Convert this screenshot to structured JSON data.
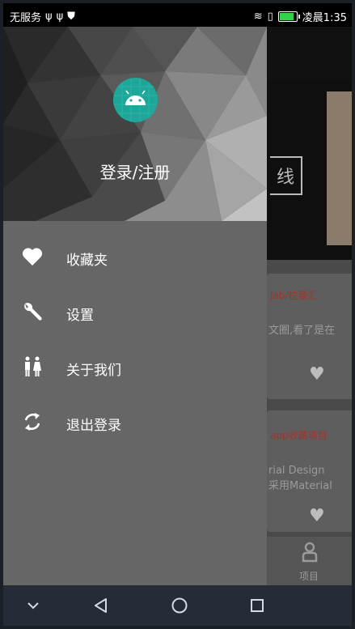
{
  "status_bar": {
    "carrier": "无服务",
    "time": "凌晨1:35"
  },
  "background": {
    "banner_text": "线",
    "card1_title": "Jab/拉曼汇",
    "card1_text": "文圈,看了是在",
    "card2_title": "app收藏项目",
    "card2_line1": "rial Design",
    "card2_line2": "采用Material",
    "tab_label": "项目"
  },
  "drawer": {
    "header_title": "登录/注册",
    "items": [
      {
        "label": "收藏夹",
        "icon": "heart-icon"
      },
      {
        "label": "设置",
        "icon": "wrench-icon"
      },
      {
        "label": "关于我们",
        "icon": "people-icon"
      },
      {
        "label": "退出登录",
        "icon": "refresh-icon"
      }
    ]
  },
  "colors": {
    "drawer_bg": "#666666",
    "avatar_bg": "#1ea799",
    "navbar_bg": "#252c38"
  }
}
